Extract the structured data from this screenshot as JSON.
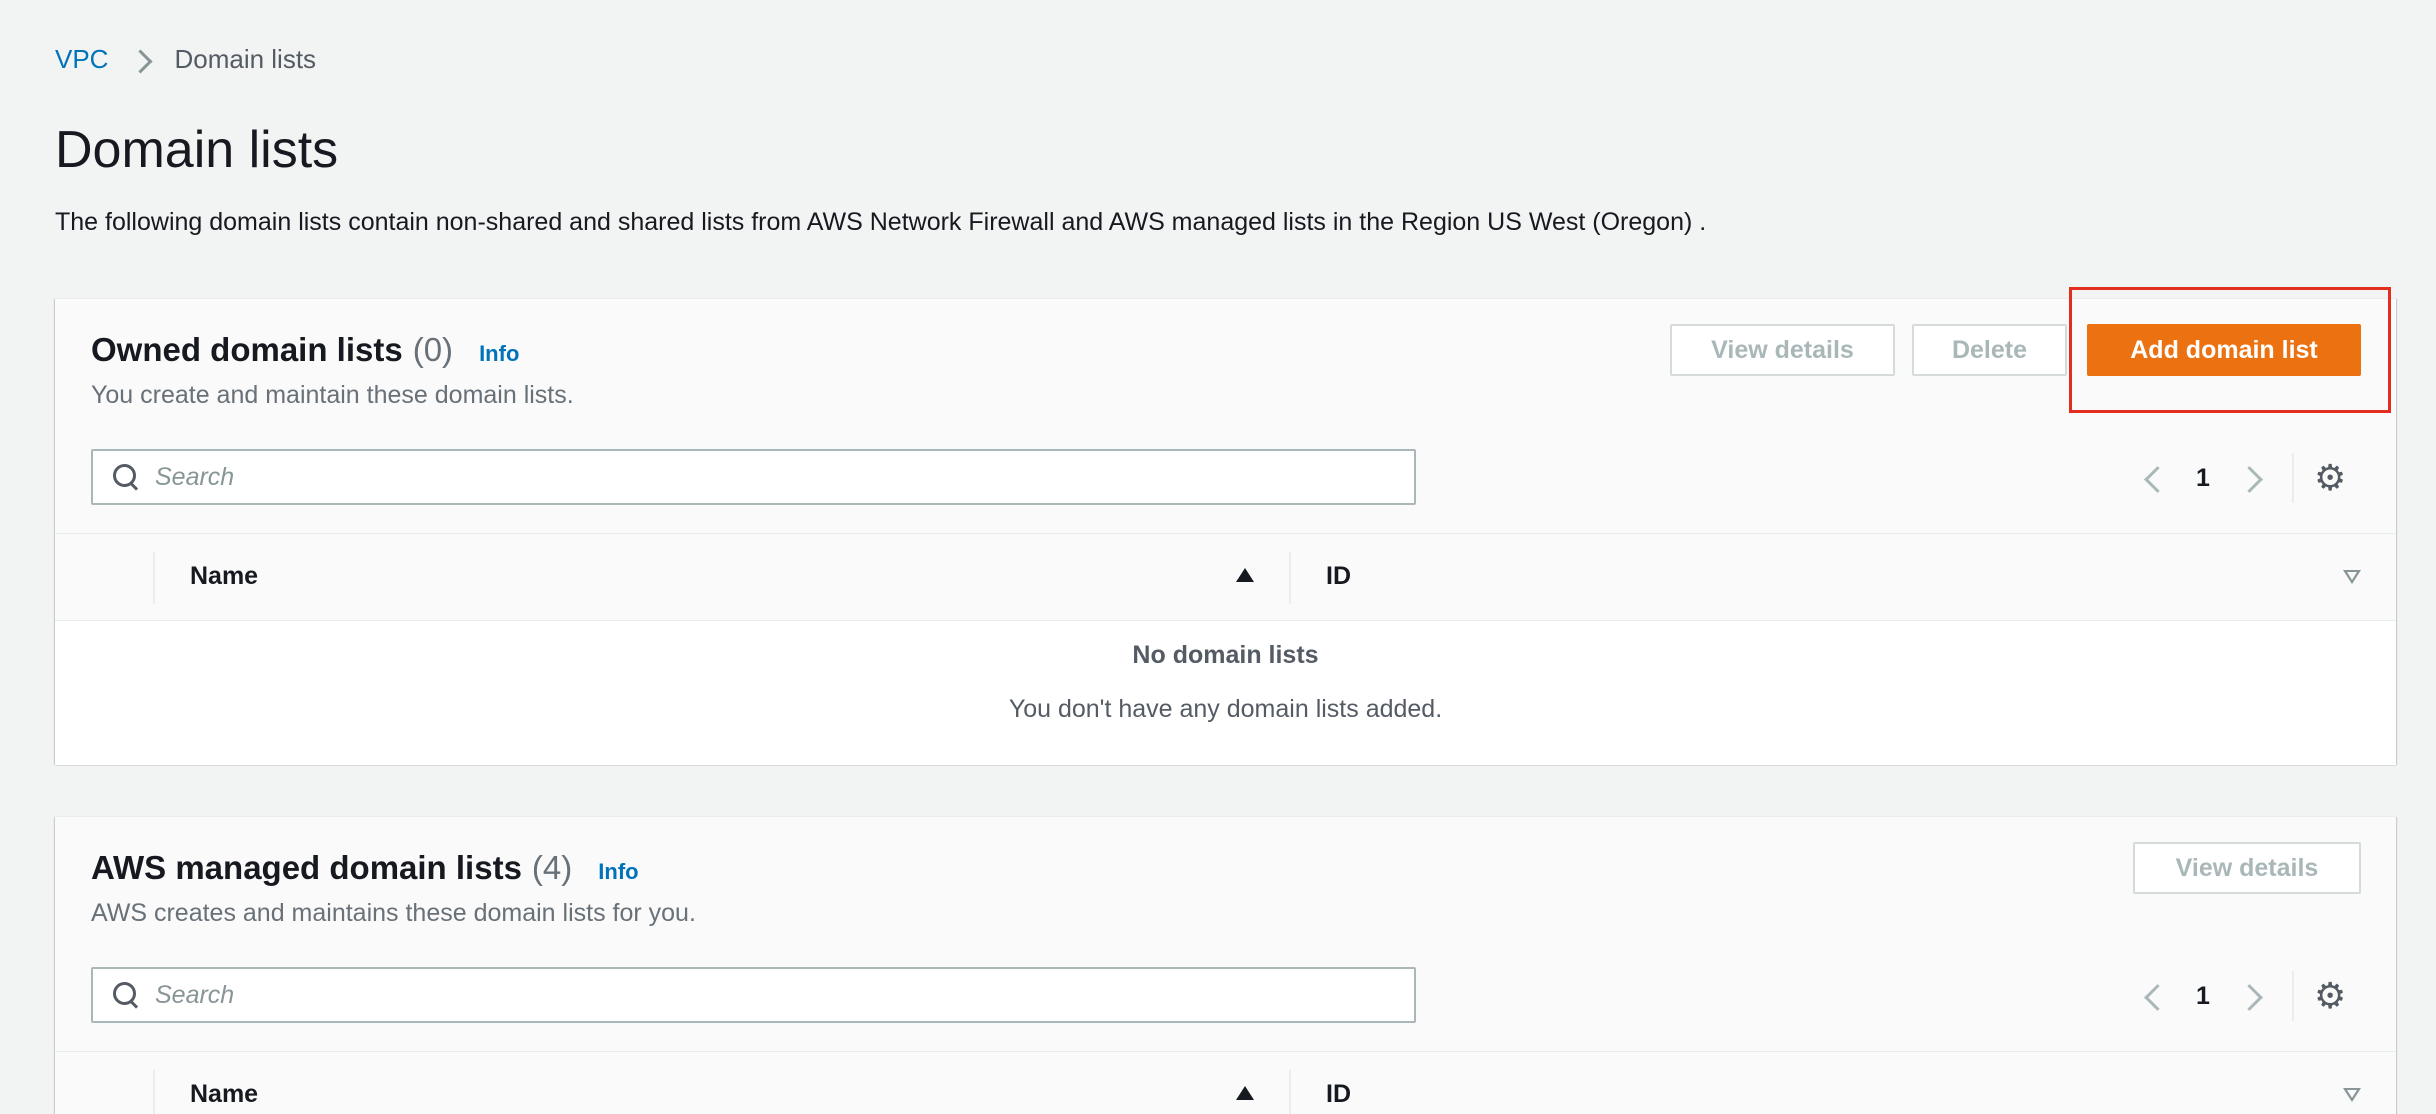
{
  "breadcrumb": {
    "parent": "VPC",
    "current": "Domain lists"
  },
  "header": {
    "title": "Domain lists",
    "description": "The following domain lists contain non-shared and shared lists from AWS Network Firewall and AWS managed lists in the Region US West (Oregon) ."
  },
  "owned": {
    "title": "Owned domain lists",
    "count": "(0)",
    "info": "Info",
    "subtitle": "You create and maintain these domain lists.",
    "view_details": "View details",
    "delete": "Delete",
    "add": "Add domain list",
    "search_placeholder": "Search",
    "page": "1",
    "columns": [
      "Name",
      "ID"
    ],
    "empty_title": "No domain lists",
    "empty_desc": "You don't have any domain lists added."
  },
  "managed": {
    "title": "AWS managed domain lists",
    "count": "(4)",
    "info": "Info",
    "subtitle": "AWS creates and maintains these domain lists for you.",
    "view_details": "View details",
    "search_placeholder": "Search",
    "page": "1",
    "columns": [
      "Name",
      "ID"
    ]
  },
  "icons": {
    "search": "search-icon",
    "settings": "gear-icon",
    "prev": "chevron-left-icon",
    "next": "chevron-right-icon"
  },
  "colors": {
    "primary_button": "#ec7211",
    "link": "#0073bb",
    "highlight": "#e22d1f"
  }
}
